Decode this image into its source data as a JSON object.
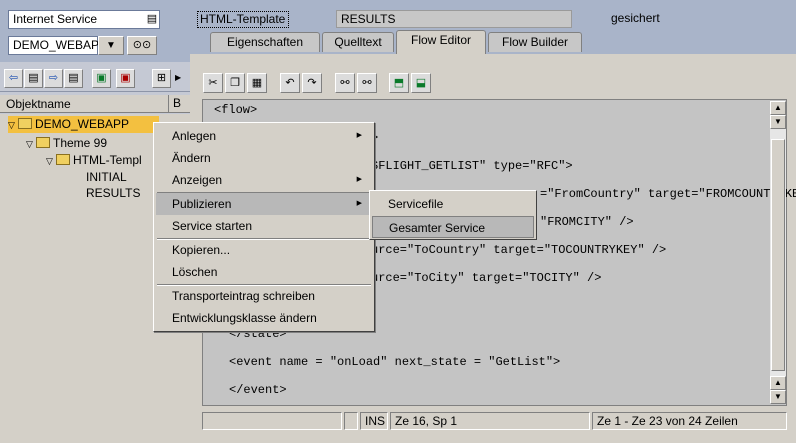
{
  "left_panel": {
    "object_type": "Internet Service",
    "object_name": "DEMO_WEBAPP",
    "column_header": "Objektname",
    "column_b": "B",
    "tree": [
      {
        "label": "DEMO_WEBAPP"
      },
      {
        "label": "Theme 99"
      },
      {
        "label": "HTML-Templ"
      },
      {
        "label": "INITIAL"
      },
      {
        "label": "RESULTS"
      }
    ]
  },
  "header": {
    "template_label": "HTML-Template",
    "template_name": "RESULTS",
    "status": "gesichert"
  },
  "tabs": [
    {
      "label": "Eigenschaften"
    },
    {
      "label": "Quelltext"
    },
    {
      "label": "Flow Editor"
    },
    {
      "label": "Flow Builder"
    }
  ],
  "editor": {
    "lines": [
      "<flow>",
      ">",
      "SFLIGHT_GETLIST\" type=\"RFC\">",
      "=\"FromCountry\" target=\"FROMCOUNTRYKEY\" />",
      "\"FROMCITY\" />",
      "urce=\"ToCountry\" target=\"TOCOUNTRYKEY\" />",
      "urce=\"ToCity\" target=\"TOCITY\" />",
      "</state>",
      "<event name = \"onLoad\" next_state = \"GetList\">",
      "</event>"
    ]
  },
  "status_bar": {
    "mode": "INS",
    "position": "Ze 16, Sp 1",
    "lines": "Ze 1 - Ze 23 von 24 Zeilen"
  },
  "context_menu": {
    "items": [
      {
        "label": "Anlegen",
        "has_submenu": true
      },
      {
        "label": "Ändern"
      },
      {
        "label": "Anzeigen",
        "has_submenu": true
      },
      {
        "label": "Publizieren",
        "has_submenu": true
      },
      {
        "label": "Service starten"
      },
      {
        "label": "Kopieren..."
      },
      {
        "label": "Löschen"
      },
      {
        "label": "Transporteintrag schreiben"
      },
      {
        "label": "Entwicklungsklasse ändern"
      }
    ],
    "submenu": [
      {
        "label": "Servicefile"
      },
      {
        "label": "Gesamter Service"
      }
    ]
  }
}
